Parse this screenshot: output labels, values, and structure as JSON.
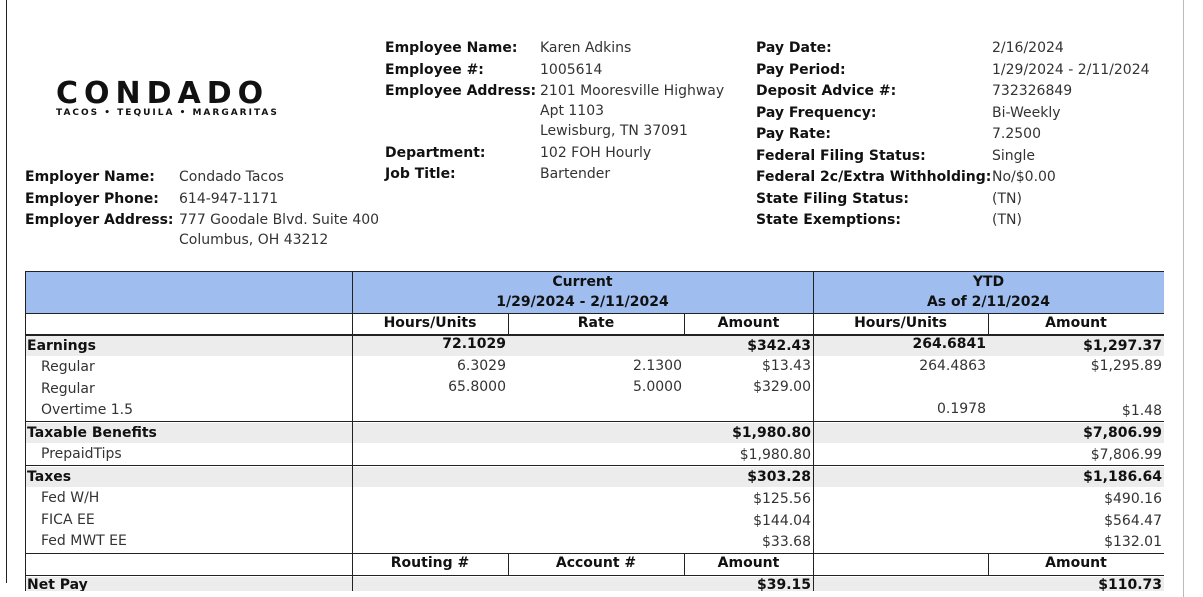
{
  "logo": {
    "word": "CONDADO",
    "tagline": "TACOS • TEQUILA • MARGARITAS"
  },
  "employer": {
    "name_label": "Employer Name:",
    "name": "Condado Tacos",
    "phone_label": "Employer Phone:",
    "phone": "614-947-1171",
    "address_label": "Employer Address:",
    "address_line1": "777 Goodale Blvd. Suite 400",
    "address_line2": "Columbus, OH 43212"
  },
  "employee": {
    "name_label": "Employee Name:",
    "name": "Karen Adkins",
    "number_label": "Employee #:",
    "number": "1005614",
    "address_label": "Employee Address:",
    "address_line1": "2101 Mooresville Highway",
    "address_line2": "Apt 1103",
    "address_line3": "Lewisburg, TN 37091",
    "department_label": "Department:",
    "department": "102 FOH Hourly",
    "job_title_label": "Job Title:",
    "job_title": "Bartender"
  },
  "pay_info": {
    "pay_date_label": "Pay Date:",
    "pay_date": "2/16/2024",
    "pay_period_label": "Pay Period:",
    "pay_period": "1/29/2024 - 2/11/2024",
    "deposit_label": "Deposit Advice #:",
    "deposit": "732326849",
    "frequency_label": "Pay Frequency:",
    "frequency": "Bi-Weekly",
    "rate_label": "Pay Rate:",
    "rate": "7.2500",
    "fed_status_label": "Federal Filing Status:",
    "fed_status": "Single",
    "fed_2c_label": "Federal 2c/Extra Withholding:",
    "fed_2c": "No/$0.00",
    "state_status_label": "State Filing Status:",
    "state_status": "(TN)",
    "state_exempt_label": "State Exemptions:",
    "state_exempt": "(TN)"
  },
  "table": {
    "current_title": "Current",
    "current_range": "1/29/2024 - 2/11/2024",
    "ytd_title": "YTD",
    "ytd_range": "As of 2/11/2024",
    "col_hours": "Hours/Units",
    "col_rate": "Rate",
    "col_amount": "Amount",
    "col_ytd_hours": "Hours/Units",
    "col_ytd_amount": "Amount",
    "col_routing": "Routing #",
    "col_account": "Account #",
    "col_dd_amount": "Amount",
    "col_dd_ytd_amount": "Amount",
    "earnings": {
      "label": "Earnings",
      "hours": "72.1029",
      "amount": "$342.43",
      "ytd_hours": "264.6841",
      "ytd_amount": "$1,297.37",
      "rows": [
        {
          "label": "Regular",
          "hours": "6.3029",
          "rate": "2.1300",
          "amount": "$13.43",
          "ytd_hours": "264.4863",
          "ytd_amount": "$1,295.89"
        },
        {
          "label": "Regular",
          "hours": "65.8000",
          "rate": "5.0000",
          "amount": "$329.00",
          "ytd_hours": "",
          "ytd_amount": ""
        },
        {
          "label": "Overtime 1.5",
          "hours": "",
          "rate": "",
          "amount": "",
          "ytd_hours": "0.1978",
          "ytd_amount": "$1.48"
        }
      ]
    },
    "taxable_benefits": {
      "label": "Taxable Benefits",
      "amount": "$1,980.80",
      "ytd_amount": "$7,806.99",
      "rows": [
        {
          "label": "PrepaidTips",
          "amount": "$1,980.80",
          "ytd_amount": "$7,806.99"
        }
      ]
    },
    "taxes": {
      "label": "Taxes",
      "amount": "$303.28",
      "ytd_amount": "$1,186.64",
      "rows": [
        {
          "label": "Fed W/H",
          "amount": "$125.56",
          "ytd_amount": "$490.16"
        },
        {
          "label": "FICA EE",
          "amount": "$144.04",
          "ytd_amount": "$564.47"
        },
        {
          "label": "Fed MWT EE",
          "amount": "$33.68",
          "ytd_amount": "$132.01"
        }
      ]
    },
    "net_pay": {
      "label": "Net Pay",
      "amount": "$39.15",
      "ytd_amount": "$110.73"
    }
  }
}
